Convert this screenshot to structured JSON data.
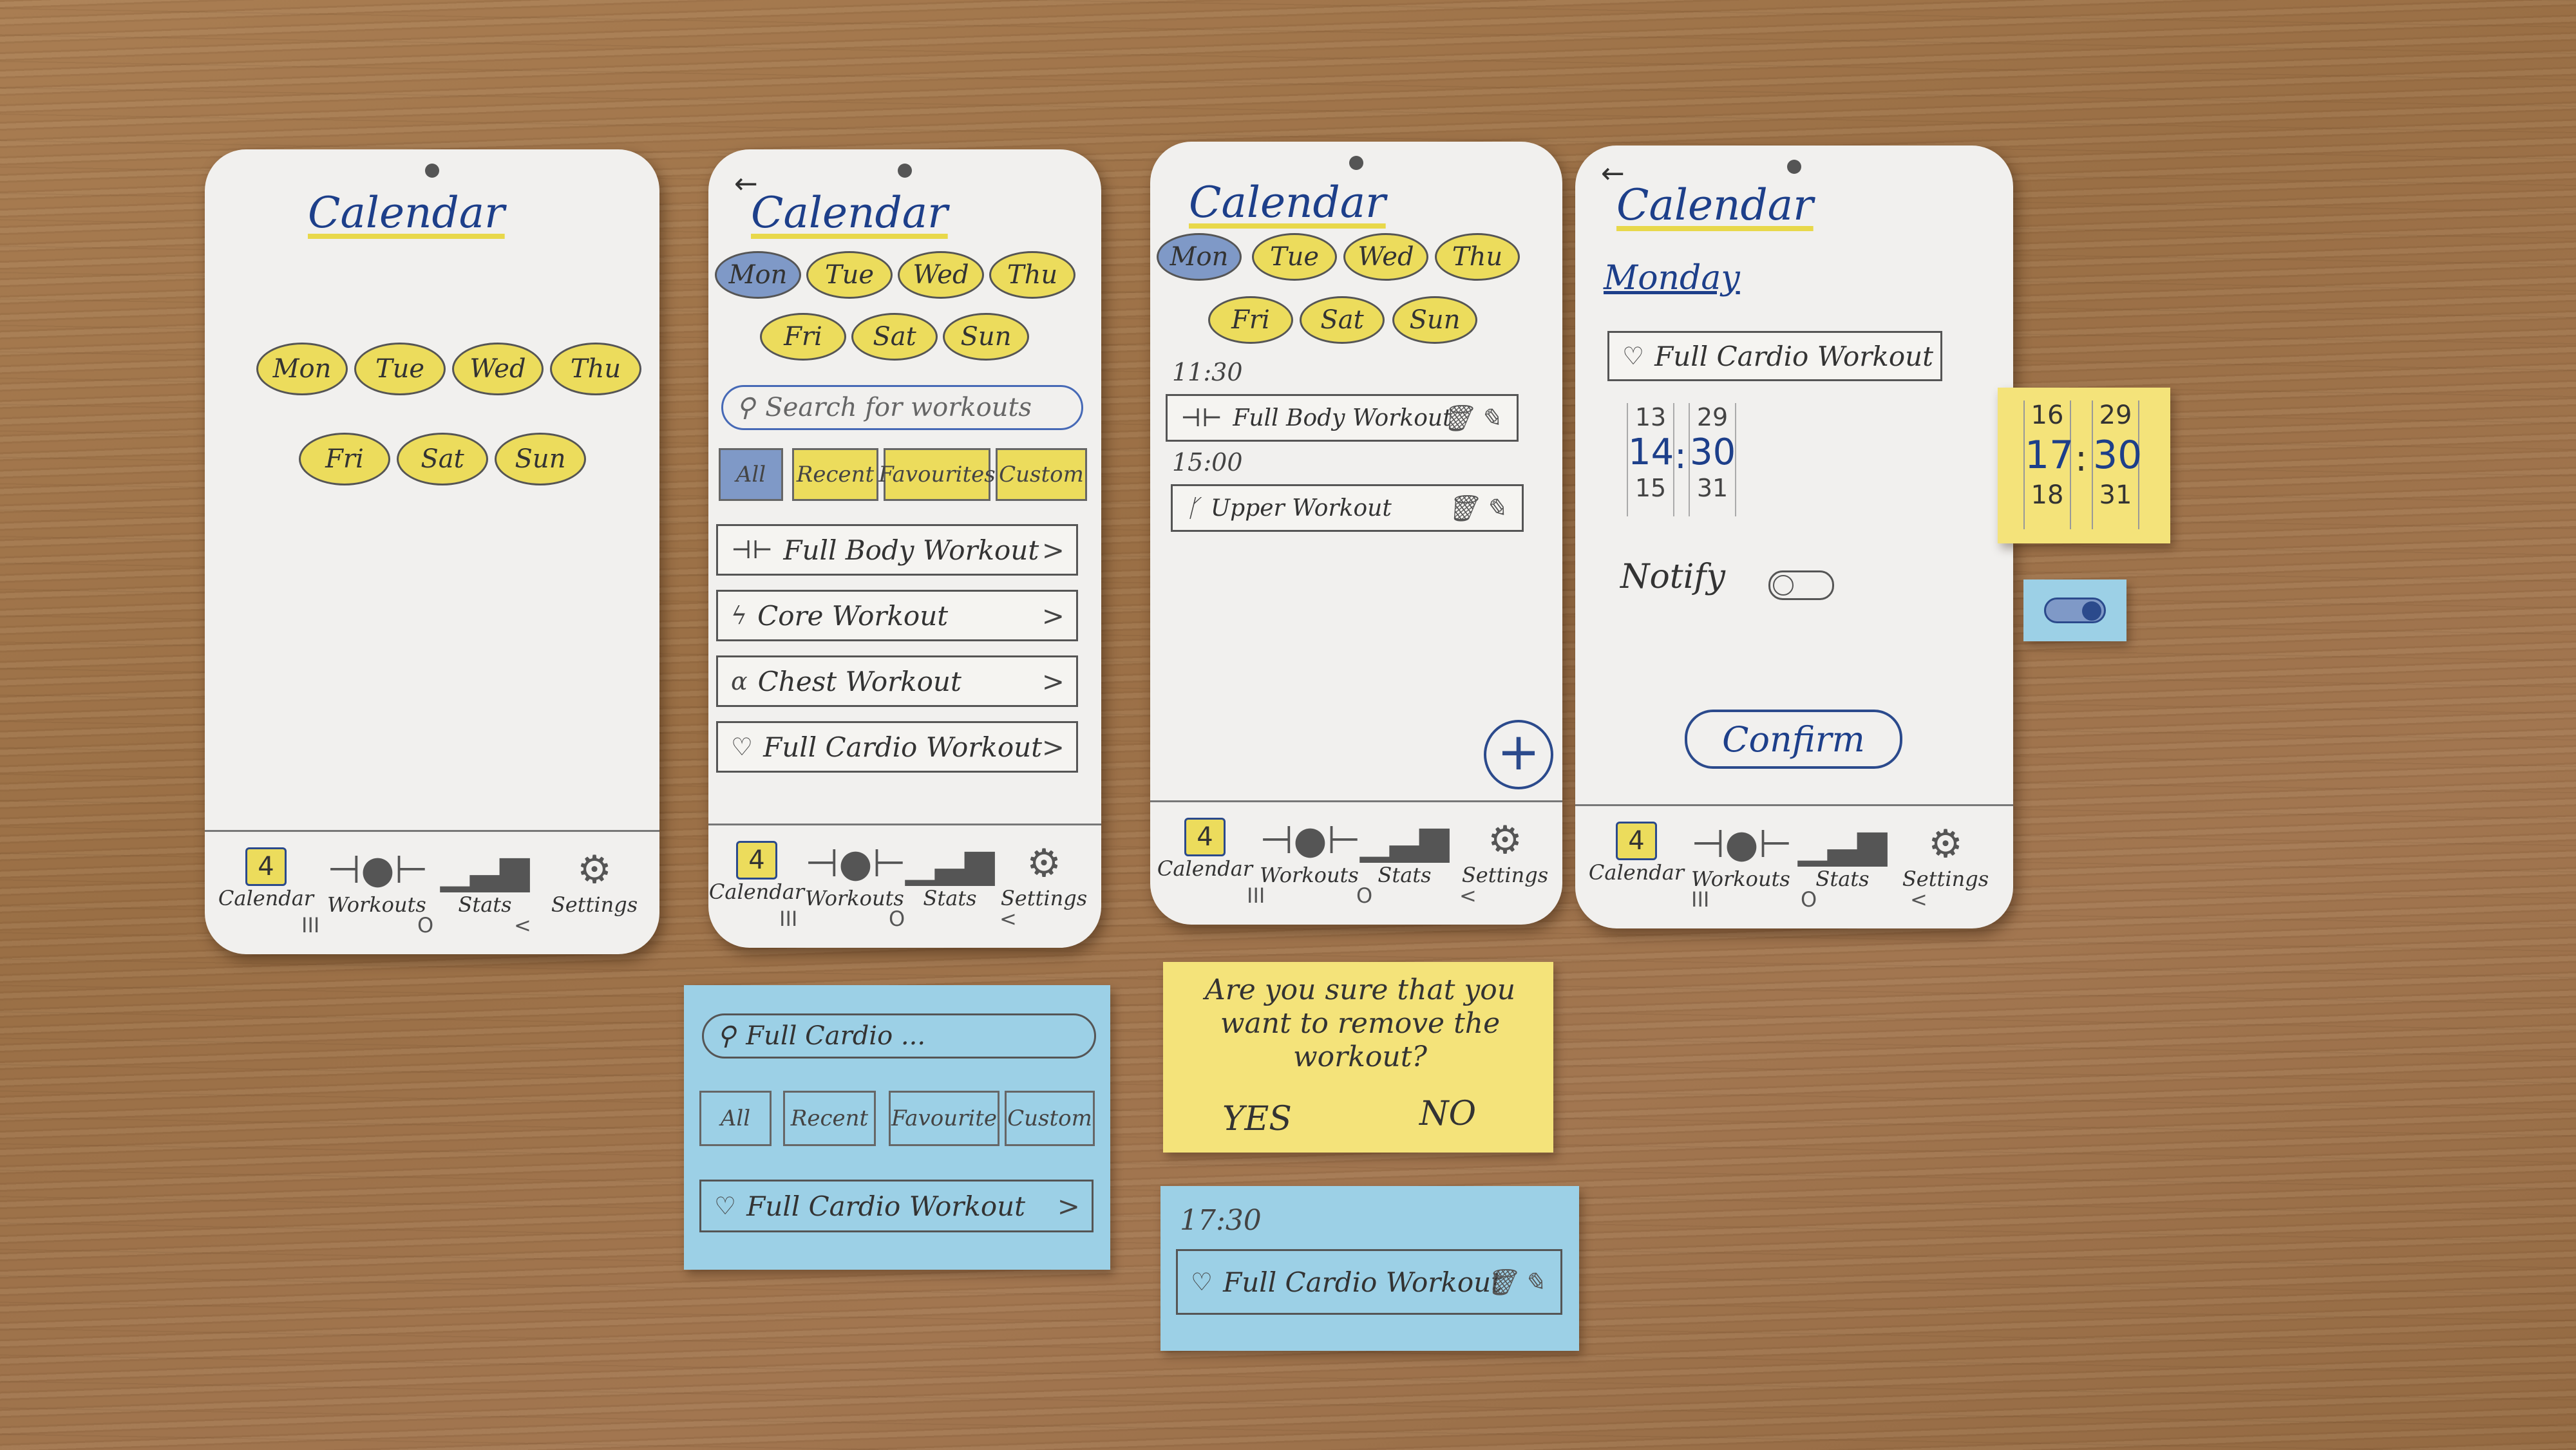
{
  "days_row1": [
    "Mon",
    "Tue",
    "Wed",
    "Thu"
  ],
  "days_row2": [
    "Fri",
    "Sat",
    "Sun"
  ],
  "screen_title": "Calendar",
  "back_arrow": "←",
  "nav": {
    "calendar": "Calendar",
    "calendar_day": "4",
    "workouts": "Workouts",
    "stats": "Stats",
    "settings": "Settings"
  },
  "sys": {
    "recent": "III",
    "home": "O",
    "back": "<"
  },
  "screen2": {
    "search_placeholder": "Search for workouts",
    "filters": [
      "All",
      "Recent",
      "Favourites",
      "Custom"
    ],
    "workouts": [
      "Full Body Workout",
      "Core Workout",
      "Chest Workout",
      "Full Cardio Workout"
    ]
  },
  "screen3": {
    "items": [
      {
        "time": "11:30",
        "name": "Full Body Workout"
      },
      {
        "time": "15:00",
        "name": "Upper Workout"
      }
    ],
    "add": "+"
  },
  "screen4": {
    "day": "Monday",
    "workout": "Full Cardio Workout",
    "picker": {
      "hour_prev": "13",
      "hour": "14",
      "hour_next": "15",
      "min_prev": "29",
      "min": "30",
      "min_next": "31",
      "sep": ":"
    },
    "notify": "Notify",
    "confirm": "Confirm"
  },
  "note_picker": {
    "hour_prev": "16",
    "hour": "17",
    "hour_next": "18",
    "min_prev": "29",
    "min": "30",
    "min_next": "31",
    "sep": ":"
  },
  "note_search": {
    "query": "Full Cardio ...",
    "filters": [
      "All",
      "Recent",
      "Favourite",
      "Custom"
    ],
    "result": "Full Cardio Workout"
  },
  "note_confirm": {
    "question": "Are you sure that you want to remove the workout?",
    "yes": "YES",
    "no": "NO"
  },
  "note_item": {
    "time": "17:30",
    "name": "Full Cardio Workout"
  },
  "colors": {
    "yellow": "#ecdc5c",
    "selected": "#7f99c7",
    "ink": "#1d3f8a",
    "wood": "#a27650"
  }
}
